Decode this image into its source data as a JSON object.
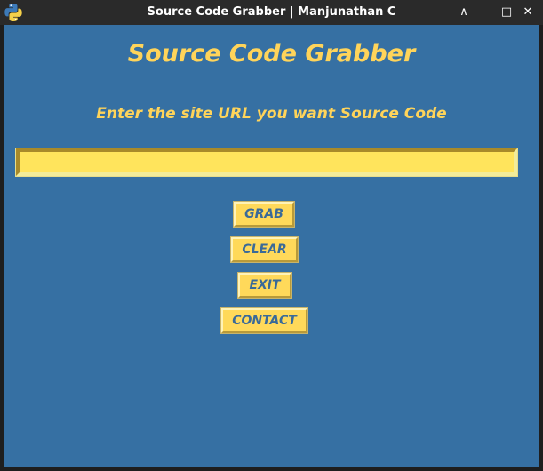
{
  "window": {
    "title": "Source Code Grabber | Manjunathan C",
    "app_icon": "python-icon",
    "controls": {
      "minimize_icon": "minimize-icon",
      "restore_icon": "restore-icon",
      "maximize_icon": "maximize-icon",
      "close_icon": "close-icon",
      "restore_glyph": "—",
      "maximize_glyph": "□",
      "close_glyph": "✕",
      "minimize_glyph": "∧"
    }
  },
  "main": {
    "heading": "Source Code Grabber",
    "prompt": "Enter the site URL you want Source Code",
    "url_input": {
      "value": "",
      "placeholder": ""
    }
  },
  "buttons": {
    "grab": "GRAB",
    "clear": "CLEAR",
    "exit": "EXIT",
    "contact": "CONTACT"
  },
  "colors": {
    "background": "#3670a3",
    "accent_yellow": "#ffd45a",
    "button_text": "#3a6a98",
    "titlebar": "#2a2a2a"
  }
}
